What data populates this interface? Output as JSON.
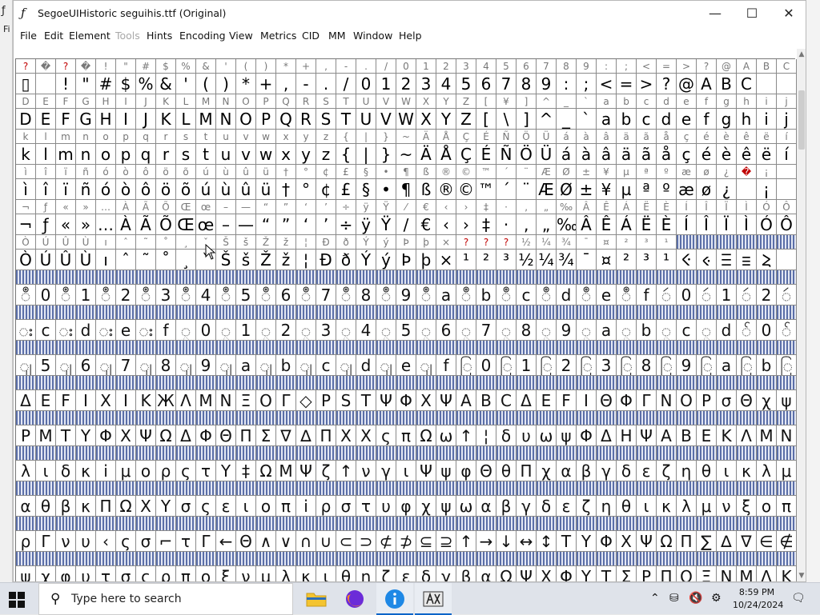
{
  "window": {
    "title": "SegoeUIHistoric  seguihis.ttf (Original)",
    "minimize_label": "—",
    "maximize_label": "☐",
    "close_label": "✕"
  },
  "background_window": {
    "partial_menu": "Fi"
  },
  "menu": [
    "File",
    "Edit",
    "Element",
    "Tools",
    "Hints",
    "Encoding",
    "View",
    "Metrics",
    "CID",
    "MM",
    "Window",
    "Help"
  ],
  "menu_disabled": [
    "Tools"
  ],
  "rows": [
    {
      "l": "?�?�!\"#$%&'()*+,-./0123456789:;<=>?@ABC",
      "q": [
        0,
        2
      ],
      "g": "▯ !\"#$%&'()*+,-./0123456789:;<=>?@ABC"
    },
    {
      "l": "DEFGHIJKLMNOPQRSTUVWXYZ[¥]^_`abcdefghij",
      "g": "DEFGHIJKLMNOPQRSTUVWXYZ[\\]^_`abcdefghij"
    },
    {
      "l": "klmnopqrstuvwxyz{|}~ÄÅÇÉÑÖÜáàâäãåçéèêëí",
      "g": "klmnopqrstuvwxyz{|}~ÄÅÇÉÑÖÜáàâäãåçéèêëí"
    },
    {
      "l": "ìîïñóòôöõúùûü†°¢£§•¶ß®©™´¨ÆØ±¥µªºæø¿�¡",
      "q": [
        36
      ],
      "g": "ìîïñóòôöõúùûü†°¢£§•¶ß®©™´¨ÆØ±¥µªºæø¿ ¡"
    },
    {
      "l": "¬ƒ«»…ÀÃÕŒœ–—“”‘’÷ÿŸ⁄€‹›‡·‚„‰ÂÊÁËÈÍÎÏÌÓÔ",
      "g": "¬ƒ«»…ÀÃÕŒœ–—“”‘’÷ÿŸ/€‹›‡·‚„‰ÂÊÁËÈÍÎÏÌÓÔ"
    },
    {
      "l": "ÒÚÛÙıˆ˜˚¸ˇŠšŽž¦ĐðÝýÞþ×???½¼¾¯¤²³¹",
      "q": [
        22,
        23,
        24
      ],
      "g": "ÒÚÛÙıˆ˜˚¸ˇŠšŽž¦ĐðÝýÞþ×¹²³½¼¾¯¤²³¹ⲴⲵⲶⲷⲸ",
      "hs": 33
    },
    {
      "g": "ဳ0ဳ1ဳ2ဳ3ဳ4ဳ5ဳ6ဳ7ဳ8ဳ9ဳaဳbဳcဳdဳeဳfဴ0ဴ1ဴ2ဴ3ဴ4ဴ5ဴ6ဴ7ဴ8ဴ9ဴaး0း1း2း3း4း5း6း7း8း9းaးb",
      "hist": true
    },
    {
      "g": "းcးdးeးf္0္1္2္3္4္5္6္7္8္9္a္b္c္d်0်1်2်3်4်5်6်7်8်9်a်b်c်d်e်fျ0ျ1ျ2ျ3ျ4",
      "hist": true
    },
    {
      "g": "ျ5ျ6ျ7ျ8ျ9ျaျbျcျdျeျfြ0ြ1ြ2ြ3ြ8ြ9ြaြbြcြdြeြfွ0ွ1ွ2ွ3ွ4ွ5၀0၀1၀2၀3၀4၀5၀6၀7၀8၀9",
      "hist": true
    },
    {
      "g": "ΔEFIXIKЖΛΜΝΞΟΓ◇PSΤΨΦΧΨABCΔEFIΘΦΓNOPσΘχψ",
      "hist": true
    },
    {
      "g": "ΡΜΤΥΦΧΨΩΔΦΘΠΣ∇∆ΠΧΧςπΩω↑¦δυωψΦΔΗΨΑΒΕΚΛΜΝ",
      "hist": true
    },
    {
      "g": "λιδκⅰμορςτΥ‡ΩΜΨζ↑νγιΨψφΘθΠχαβγδεζηθικλμ",
      "hist": true
    },
    {
      "g": "αθβκΠΩΧΥσςειοπⅰρστυφχψωαβγδεζηθικλμνξοπ",
      "hist": true
    },
    {
      "g": "ρΓνυ‹ςσ⌐τΓ←Θ∧∨∩∪⊂⊃⊄⊅⊆⊇↑→↓↔↕ΤΥΦΧΨΩΠ∑∆∇∈∉",
      "hist": true
    },
    {
      "g": "ψχφυτσςρποξνμλκιθηζεδγβαΩΨΧΦΥΤΣΡΠΟΞΝΜΛΚ",
      "hist": true
    }
  ],
  "taskbar": {
    "search_placeholder": "Type here to search",
    "time": "8:59 PM",
    "date": "10/24/2024"
  }
}
